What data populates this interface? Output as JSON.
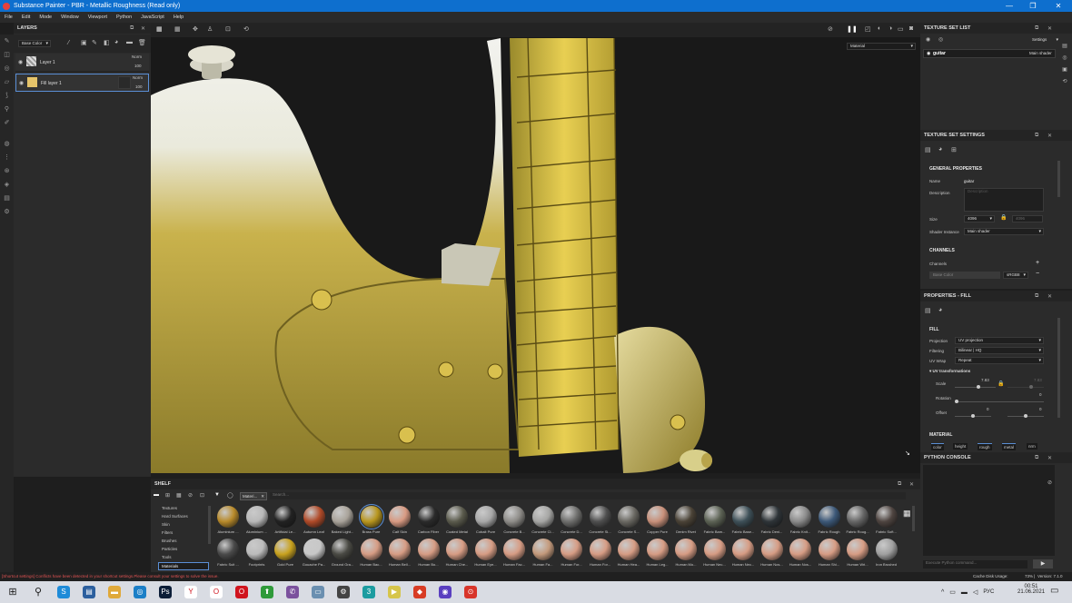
{
  "window": {
    "title": "Substance Painter - PBR - Metallic Roughness (Read only)",
    "controls": [
      "—",
      "❐",
      "✕"
    ]
  },
  "menu": [
    "File",
    "Edit",
    "Mode",
    "Window",
    "Viewport",
    "Python",
    "JavaScript",
    "Help"
  ],
  "layers_panel": {
    "title": "LAYERS",
    "channel": "Base Color",
    "layers": [
      {
        "name": "Layer 1",
        "blend": "Norm",
        "opacity": "100"
      },
      {
        "name": "Fill layer 1",
        "blend": "Norm",
        "opacity": "100"
      }
    ]
  },
  "viewport": {
    "mode": "Material"
  },
  "texture_set_list": {
    "title": "TEXTURE SET LIST",
    "settings": "Settings",
    "item": "guitar",
    "shader": "Main shader"
  },
  "texture_set_settings": {
    "title": "TEXTURE SET SETTINGS",
    "general": "GENERAL PROPERTIES",
    "name_label": "Name",
    "name_value": "guitar",
    "description_label": "Description",
    "description_placeholder": "Description",
    "size_label": "Size",
    "size_value": "4096",
    "size_value2": "4096",
    "shader_label": "Shader Instance",
    "shader_value": "Main shader",
    "channels": "CHANNELS",
    "channels_label": "Channels",
    "base_color": "Base Color",
    "base_color_format": "sRGB8"
  },
  "properties_fill": {
    "title": "PROPERTIES - FILL",
    "fill": "FILL",
    "projection_label": "Projection",
    "projection_value": "UV projection",
    "filtering_label": "Filtering",
    "filtering_value": "Bilinear | HQ",
    "uvwrap_label": "UV Wrap",
    "uvwrap_value": "Repeat",
    "uvtrans": "UV transformations",
    "scale_label": "Scale",
    "scale_value": "7.83",
    "scale_value2": "7.83",
    "rotation_label": "Rotation",
    "rotation_value": "0",
    "offset_label": "Offset",
    "offset_value1": "0",
    "offset_value2": "0",
    "material": "MATERIAL",
    "material_tabs": [
      "color",
      "height",
      "rough",
      "metal",
      "nrm"
    ]
  },
  "python_console": {
    "title": "PYTHON CONSOLE",
    "placeholder": "Execute Python command...",
    "run": "▶"
  },
  "shelf": {
    "title": "SHELF",
    "filter_tag": "Materi...",
    "search_placeholder": "Search...",
    "categories": [
      "Textures",
      "Hard Surfaces",
      "Skin",
      "Filters",
      "Brushes",
      "Particles",
      "Tools",
      "Materials"
    ],
    "selected_category": "Materials",
    "row1": [
      {
        "name": "Aluminium ...",
        "color": "#b88a2a"
      },
      {
        "name": "Aluminium ...",
        "color": "#b9b9b9"
      },
      {
        "name": "Artificial Le...",
        "color": "#222222"
      },
      {
        "name": "Autumn Leaf",
        "color": "#b04a28"
      },
      {
        "name": "Baked Light...",
        "color": "#a9a39a"
      },
      {
        "name": "Brass Pure",
        "color": "#b8961e"
      },
      {
        "name": "Calf Skin",
        "color": "#d89a82"
      },
      {
        "name": "Carbon Fiber",
        "color": "#2a2a2a"
      },
      {
        "name": "Coated Metal",
        "color": "#5a5a4c"
      },
      {
        "name": "Cobalt Pure",
        "color": "#a8a8a8"
      },
      {
        "name": "Concrete B...",
        "color": "#8e8c88"
      },
      {
        "name": "Concrete Cl...",
        "color": "#a6a6a4"
      },
      {
        "name": "Concrete D...",
        "color": "#6e6e6c"
      },
      {
        "name": "Concrete Si...",
        "color": "#4f4f4f"
      },
      {
        "name": "Concrete S...",
        "color": "#6a6862"
      },
      {
        "name": "Copper Pure",
        "color": "#c8907a"
      },
      {
        "name": "Denim Rivet",
        "color": "#4a4236"
      },
      {
        "name": "Fabric Bam...",
        "color": "#5c6254"
      },
      {
        "name": "Fabric Base...",
        "color": "#3e5058"
      },
      {
        "name": "Fabric Deni...",
        "color": "#2e3438"
      },
      {
        "name": "Fabric Knit...",
        "color": "#8a8a8a"
      },
      {
        "name": "Fabric Rough",
        "color": "#3c5878"
      },
      {
        "name": "Fabric Roug...",
        "color": "#666666"
      },
      {
        "name": "Fabric Soft...",
        "color": "#4e4440"
      }
    ],
    "row2": [
      {
        "name": "Fabric Suit ...",
        "color": "#4a4a4a"
      },
      {
        "name": "Footprints",
        "color": "#bcbcbc"
      },
      {
        "name": "Gold Pure",
        "color": "#c9a21e"
      },
      {
        "name": "Gouache Pa...",
        "color": "#c8c8c8"
      },
      {
        "name": "Ground Gra...",
        "color": "#4a4a44"
      },
      {
        "name": "Human Bac...",
        "color": "#d69c84"
      },
      {
        "name": "Human Bell...",
        "color": "#d69c84"
      },
      {
        "name": "Human Bo...",
        "color": "#d69c84"
      },
      {
        "name": "Human Che...",
        "color": "#d69c84"
      },
      {
        "name": "Human Eye...",
        "color": "#d69c84"
      },
      {
        "name": "Human Fac...",
        "color": "#d69c84"
      },
      {
        "name": "Human Fa...",
        "color": "#c49a7c"
      },
      {
        "name": "Human For...",
        "color": "#d69c84"
      },
      {
        "name": "Human For...",
        "color": "#d69c84"
      },
      {
        "name": "Human Hea...",
        "color": "#d69c84"
      },
      {
        "name": "Human Leg...",
        "color": "#d69c84"
      },
      {
        "name": "Human Mo...",
        "color": "#d69c84"
      },
      {
        "name": "Human Nec...",
        "color": "#d69c84"
      },
      {
        "name": "Human Nec...",
        "color": "#d69c84"
      },
      {
        "name": "Human Nos...",
        "color": "#d69c84"
      },
      {
        "name": "Human Nos...",
        "color": "#d69c84"
      },
      {
        "name": "Human Shi...",
        "color": "#d69c84"
      },
      {
        "name": "Human Wri...",
        "color": "#d69c84"
      },
      {
        "name": "Iron Brushed",
        "color": "#a0a0a0"
      }
    ]
  },
  "status": {
    "warning": "[Shortcut settings] Conflicts have been detected in your shortcut settings.Please consult your settings to solve the issue.",
    "cache": "Cache Disk Usage:",
    "cache_pct": "73%",
    "version": "Version: 7.1.0"
  },
  "taskbar": {
    "apps": [
      {
        "icon": "S",
        "color": "#1e8bd8"
      },
      {
        "icon": "▤",
        "color": "#2c5f9e"
      },
      {
        "icon": "▬",
        "color": "#e0a93a"
      },
      {
        "icon": "◎",
        "color": "#1c7fc7"
      },
      {
        "icon": "Ps",
        "color": "#0b1d37"
      },
      {
        "icon": "Y",
        "color": "#ffffff"
      },
      {
        "icon": "O",
        "color": "#ffffff"
      },
      {
        "icon": "O",
        "color": "#d0141e"
      },
      {
        "icon": "⬆",
        "color": "#2f9a3a"
      },
      {
        "icon": "✆",
        "color": "#7b519d"
      },
      {
        "icon": "▭",
        "color": "#6a8fb0"
      },
      {
        "icon": "⚙",
        "color": "#444444"
      },
      {
        "icon": "3",
        "color": "#1c9ca0"
      },
      {
        "icon": "▶",
        "color": "#d6c54a"
      },
      {
        "icon": "◆",
        "color": "#d83c24"
      },
      {
        "icon": "◉",
        "color": "#5a3fc0"
      },
      {
        "icon": "⊙",
        "color": "#d8352a"
      }
    ],
    "lang": "РУС",
    "time": "00:51",
    "date": "21.06.2021"
  }
}
